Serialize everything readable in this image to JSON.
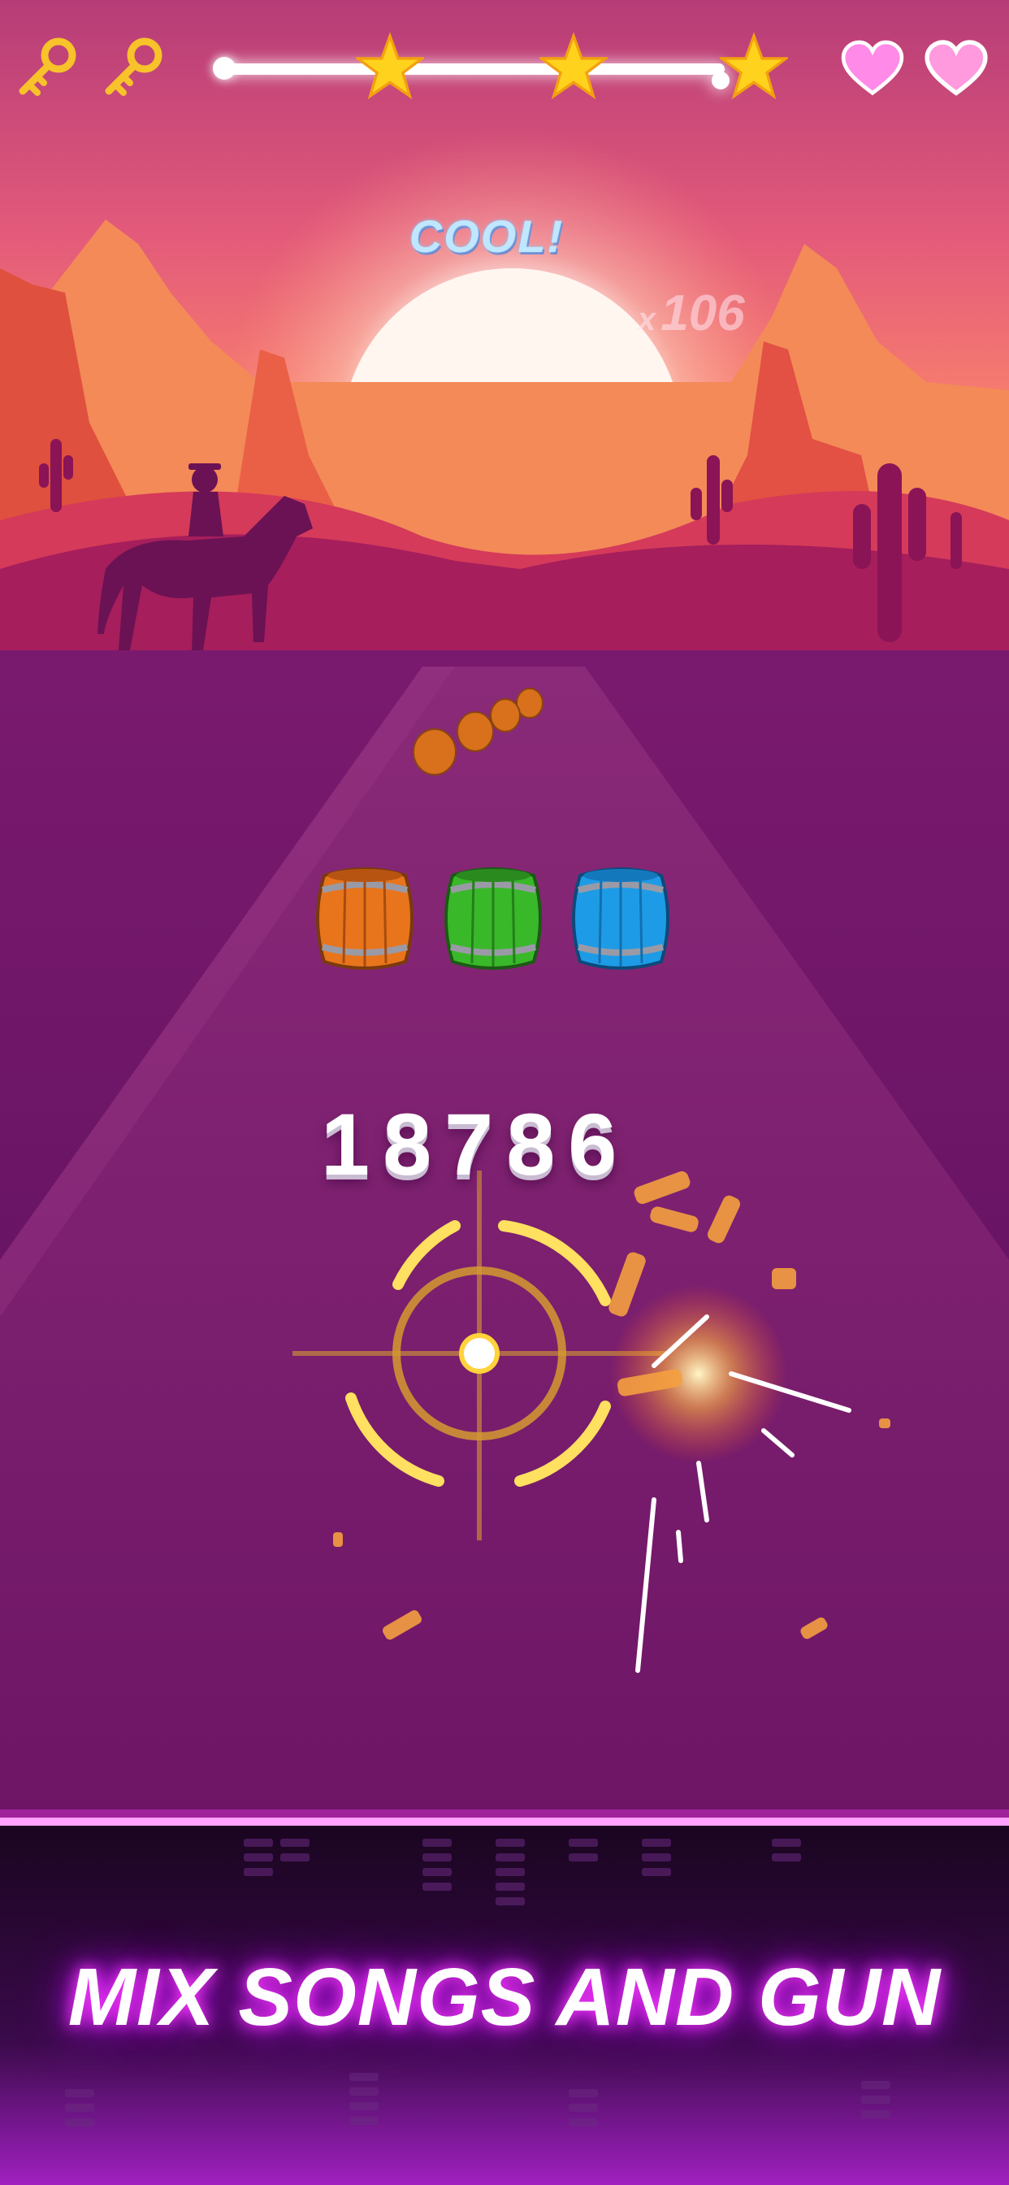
{
  "hud": {
    "keys": 2,
    "hearts": 2,
    "stars_total": 3,
    "stars_earned": 3,
    "progress": 0.98
  },
  "feedback": {
    "judgement": "COOL!",
    "combo_prefix": "x",
    "combo_value": "106"
  },
  "score": "18786",
  "lanes": [
    {
      "color": "orange",
      "hex": "#e8741c"
    },
    {
      "color": "green",
      "hex": "#39b82a"
    },
    {
      "color": "blue",
      "hex": "#1e9be6"
    }
  ],
  "banner": {
    "text": "MIX SONGS AND GUN"
  },
  "colors": {
    "sky_top": "#b63c78",
    "sunset": "#ff7a5c",
    "road": "#6e1566",
    "crosshair": "#ffd23c",
    "neon": "#ff3dff"
  }
}
